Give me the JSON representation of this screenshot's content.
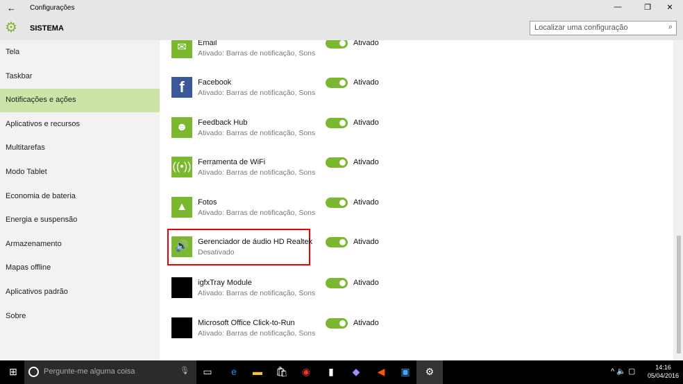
{
  "window": {
    "title": "Configurações",
    "back": "←",
    "minimize": "—",
    "maximize": "❐",
    "close": "✕"
  },
  "header": {
    "section": "SISTEMA",
    "search_placeholder": "Localizar uma configuração"
  },
  "sidebar": {
    "items": [
      {
        "label": "Tela"
      },
      {
        "label": "Taskbar"
      },
      {
        "label": "Notificações e ações",
        "selected": true
      },
      {
        "label": "Aplicativos e recursos"
      },
      {
        "label": "Multitarefas"
      },
      {
        "label": "Modo Tablet"
      },
      {
        "label": "Economia de bateria"
      },
      {
        "label": "Energia e suspensão"
      },
      {
        "label": "Armazenamento"
      },
      {
        "label": "Mapas offline"
      },
      {
        "label": "Aplicativos padrão"
      },
      {
        "label": "Sobre"
      }
    ]
  },
  "apps": [
    {
      "name": "Email",
      "sub": "Ativado: Barras de notificação, Sons",
      "state": "Ativado",
      "icon": "mail-icon",
      "glyph": "✉"
    },
    {
      "name": "Facebook",
      "sub": "Ativado: Barras de notificação, Sons",
      "state": "Ativado",
      "icon": "facebook-icon",
      "glyph": "f"
    },
    {
      "name": "Feedback Hub",
      "sub": "Ativado: Barras de notificação, Sons",
      "state": "Ativado",
      "icon": "feedback-icon",
      "glyph": "☻"
    },
    {
      "name": "Ferramenta de WiFi",
      "sub": "Ativado: Barras de notificação, Sons",
      "state": "Ativado",
      "icon": "wifi-icon",
      "glyph": "((•))"
    },
    {
      "name": "Fotos",
      "sub": "Ativado: Barras de notificação, Sons",
      "state": "Ativado",
      "icon": "photos-icon",
      "glyph": "▲"
    },
    {
      "name": "Gerenciador de áudio HD Realtek",
      "sub": "Desativado",
      "state": "Ativado",
      "icon": "speaker-icon",
      "glyph": "🔊"
    },
    {
      "name": "igfxTray Module",
      "sub": "Ativado: Barras de notificação, Sons",
      "state": "Ativado",
      "icon": "app-icon",
      "glyph": ""
    },
    {
      "name": "Microsoft Office Click-to-Run",
      "sub": "Ativado: Barras de notificação, Sons",
      "state": "Ativado",
      "icon": "app-icon",
      "glyph": ""
    }
  ],
  "taskbar": {
    "search_placeholder": "Pergunte-me alguma coisa",
    "time": "14:16",
    "date": "05/04/2016"
  },
  "colors": {
    "accent": "#7cb82f",
    "selected": "#cde4a8",
    "highlight": "#e00000"
  }
}
